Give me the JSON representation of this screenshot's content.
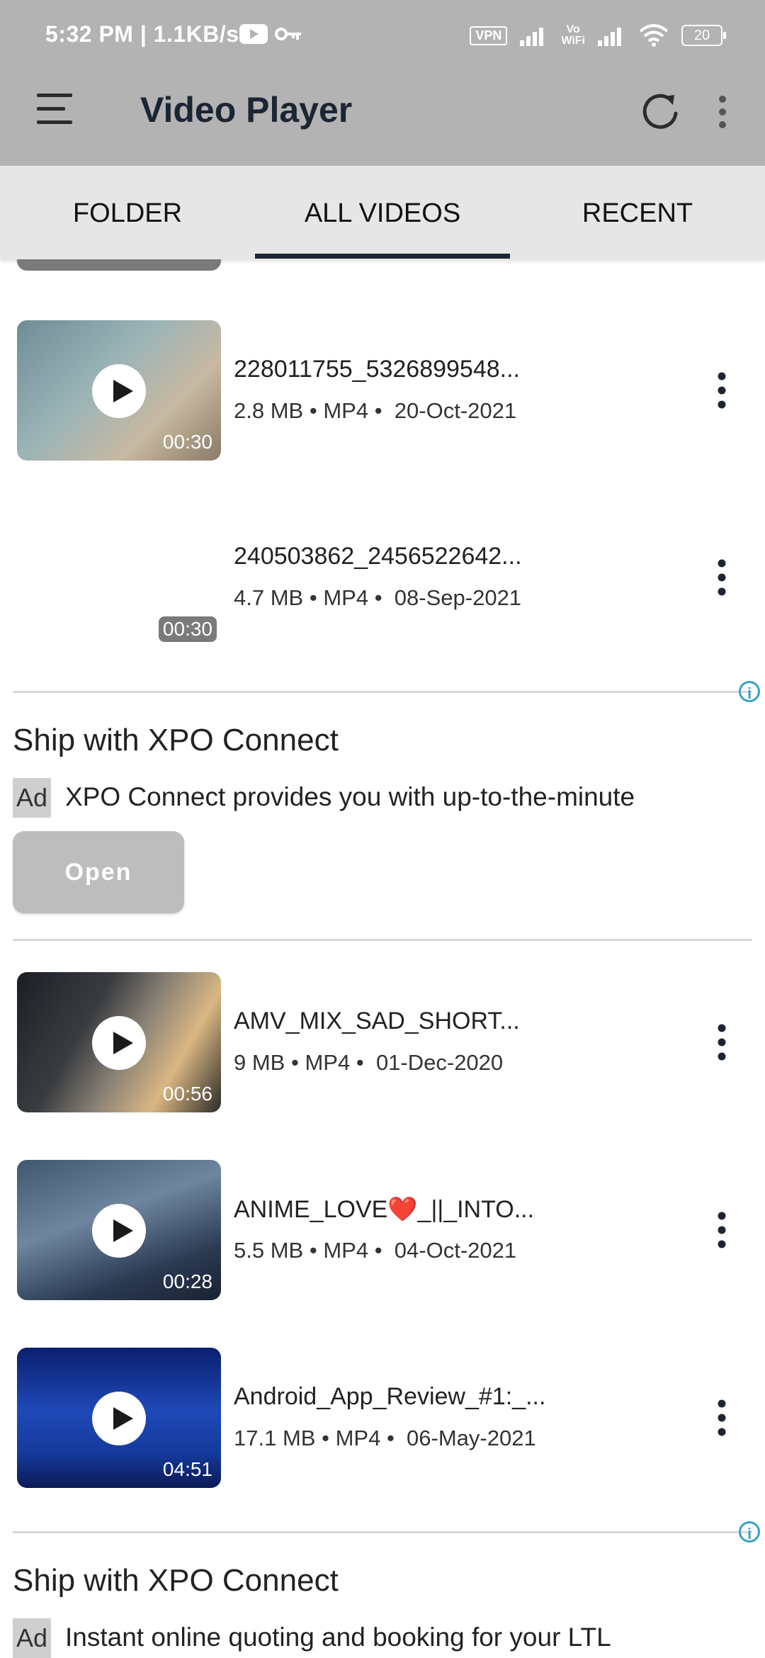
{
  "status_bar": {
    "time": "5:32 PM | 1.1KB/s",
    "vpn": "VPN",
    "vowifi": "Vo\nWiFi",
    "battery": "20"
  },
  "app_bar": {
    "title": "Video Player",
    "icons": [
      "menu-icon",
      "refresh-icon",
      "more-vert-icon"
    ]
  },
  "tabs": [
    {
      "label": "FOLDER",
      "selected": false
    },
    {
      "label": "ALL VIDEOS",
      "selected": true
    },
    {
      "label": "RECENT",
      "selected": false
    }
  ],
  "videos": [
    {
      "title": "228011755_5326899548...",
      "size": "2.8 MB",
      "format": "MP4",
      "date": "20-Oct-2021",
      "duration": "00:30"
    },
    {
      "title": "240503862_2456522642...",
      "size": "4.7 MB",
      "format": "MP4",
      "date": "08-Sep-2021",
      "duration": "00:30"
    },
    {
      "title": "AMV_MIX_SAD_SHORT...",
      "size": "9 MB",
      "format": "MP4",
      "date": "01-Dec-2020",
      "duration": "00:56"
    },
    {
      "title": "ANIME_LOVE❤️_||_INTO...",
      "size": "5.5 MB",
      "format": "MP4",
      "date": "04-Oct-2021",
      "duration": "00:28"
    },
    {
      "title": "Android_App_Review_#1:_...",
      "size": "17.1 MB",
      "format": "MP4",
      "date": "06-May-2021",
      "duration": "04:51"
    }
  ],
  "meta_separator": "•",
  "ads": [
    {
      "headline": "Ship with XPO Connect",
      "badge": "Ad",
      "body": "XPO Connect provides you with up-to-the-minute",
      "button": "Open"
    },
    {
      "headline": "Ship with XPO Connect",
      "badge": "Ad",
      "body": "Instant online quoting and booking for your LTL"
    }
  ],
  "colors": {
    "app_bar": "#b3b3b3",
    "tab_bar": "#e6e6e6",
    "tab_indicator": "#1c2533",
    "ad_info": "#3aa1c7"
  }
}
